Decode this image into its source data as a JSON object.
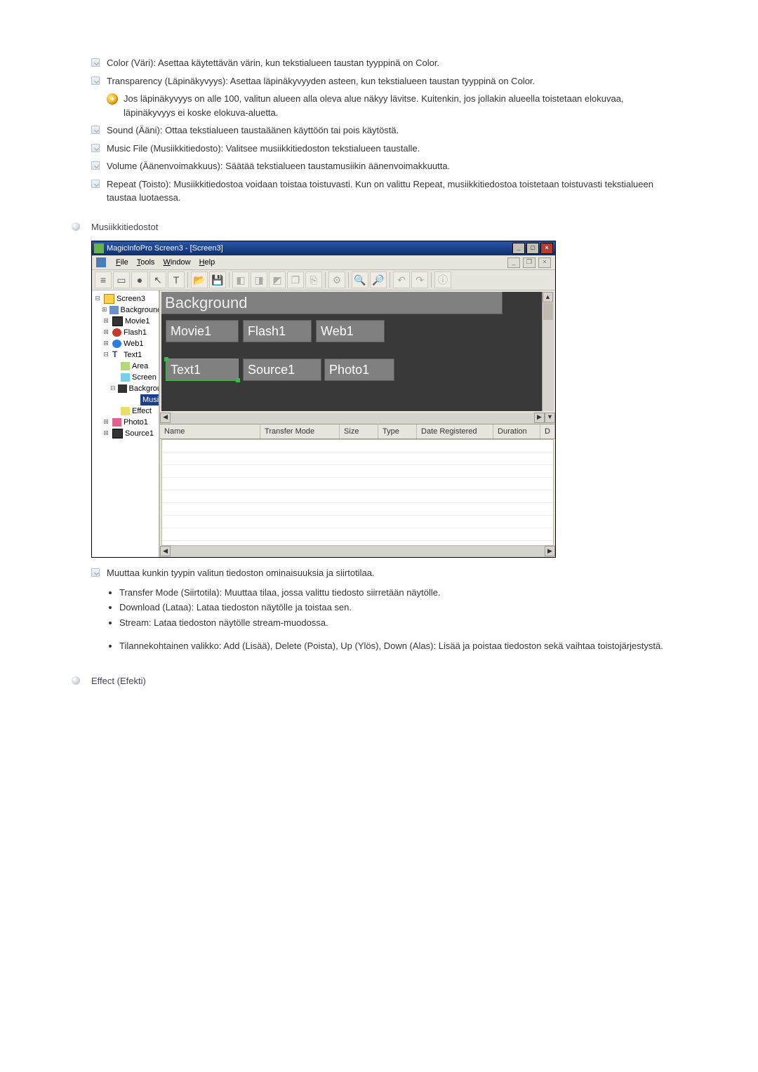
{
  "bullets": {
    "color": "Color (Väri): Asettaa käytettävän värin, kun tekstialueen taustan tyyppinä on Color.",
    "transparency": "Transparency (Läpinäkyvyys): Asettaa läpinäkyvyyden asteen, kun tekstialueen taustan tyyppinä on Color.",
    "transparency_note": "Jos läpinäkyvyys on alle 100, valitun alueen alla oleva alue näkyy lävitse. Kuitenkin, jos jollakin alueella toistetaan elokuvaa, läpinäkyvyys ei koske elokuva-aluetta.",
    "sound": "Sound (Ääni): Ottaa tekstialueen taustaäänen käyttöön tai pois käytöstä.",
    "musicfile": "Music File (Musiikkitiedosto): Valitsee musiikkitiedoston tekstialueen taustalle.",
    "volume": "Volume (Äänenvoimakkuus): Säätää tekstialueen taustamusiikin äänenvoimakkuutta.",
    "repeat": "Repeat (Toisto): Musiikkitiedostoa voidaan toistaa toistuvasti. Kun on valittu Repeat, musiikkitiedostoa toistetaan toistuvasti tekstialueen taustaa luotaessa."
  },
  "section_music": "Musiikkitiedostot",
  "app": {
    "title": "MagicInfoPro Screen3 - [Screen3]",
    "menu_file": "File",
    "menu_tools": "Tools",
    "menu_window": "Window",
    "menu_help": "Help"
  },
  "tree": {
    "screen3": "Screen3",
    "background": "Background",
    "movie1": "Movie1",
    "flash1": "Flash1",
    "web1": "Web1",
    "text1": "Text1",
    "area": "Area",
    "screen": "Screen",
    "bg2": "Background",
    "musicfile": "Music File",
    "effect": "Effect",
    "photo1": "Photo1",
    "source1": "Source1"
  },
  "canvas": {
    "bg": "Background",
    "movie1": "Movie1",
    "flash1": "Flash1",
    "web1": "Web1",
    "text1": "Text1",
    "source1": "Source1",
    "photo1": "Photo1"
  },
  "grid": {
    "name": "Name",
    "transfer": "Transfer Mode",
    "size": "Size",
    "type": "Type",
    "date": "Date Registered",
    "duration": "Duration",
    "d": "D"
  },
  "footnote": "Muuttaa kunkin tyypin valitun tiedoston ominaisuuksia ja siirtotilaa.",
  "sub": {
    "transfer": "Transfer Mode (Siirtotila): Muuttaa tilaa, jossa valittu tiedosto siirretään näytölle.",
    "download": "Download (Lataa): Lataa tiedoston näytölle ja toistaa sen.",
    "stream": "Stream: Lataa tiedoston näytölle stream-muodossa.",
    "context": "Tilannekohtainen valikko: Add (Lisää), Delete (Poista), Up (Ylös), Down (Alas): Lisää ja poistaa tiedoston sekä vaihtaa toistojärjestystä."
  },
  "section_effect": "Effect (Efekti)"
}
